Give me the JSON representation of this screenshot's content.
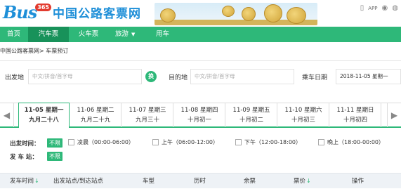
{
  "header": {
    "logo_text": "Bus",
    "logo_badge": "365",
    "logo_cn": "中国公路客票网",
    "app_label": "APP"
  },
  "nav": {
    "items": [
      "首页",
      "汽车票",
      "火车票",
      "旅游",
      "用车"
    ],
    "active_index": 1
  },
  "breadcrumb": "中国公路客票网> 车票预订",
  "search": {
    "from_label": "出发地",
    "from_placeholder": "中文/拼音/首字母",
    "swap_label": "换",
    "to_label": "目的地",
    "to_placeholder": "中文/拼音/首字母",
    "date_label": "乘车日期",
    "date_value": "2018-11-05 星期一"
  },
  "dates": [
    {
      "date": "11-05 星期一",
      "lunar": "九月二十八"
    },
    {
      "date": "11-06 星期二",
      "lunar": "九月二十九"
    },
    {
      "date": "11-07 星期三",
      "lunar": "九月三十"
    },
    {
      "date": "11-08 星期四",
      "lunar": "十月初一"
    },
    {
      "date": "11-09 星期五",
      "lunar": "十月初二"
    },
    {
      "date": "11-10 星期六",
      "lunar": "十月初三"
    },
    {
      "date": "11-11 星期日",
      "lunar": "十月初四"
    }
  ],
  "filters": {
    "time_label": "出发时间：",
    "station_label": "发 车 站：",
    "unlimited": "不限",
    "time_options": [
      "凌晨（00:00-06:00）",
      "上午（06:00-12:00）",
      "下午（12:00-18:00）",
      "晚上（18:00-00:00）"
    ]
  },
  "table": {
    "headers": [
      "发车时间",
      "出发站点/到达站点",
      "车型",
      "历时",
      "余票",
      "票价",
      "操作"
    ],
    "sort_icon": "↓"
  },
  "colors": {
    "brand_green": "#2eb879",
    "brand_blue": "#1e8fd8"
  }
}
